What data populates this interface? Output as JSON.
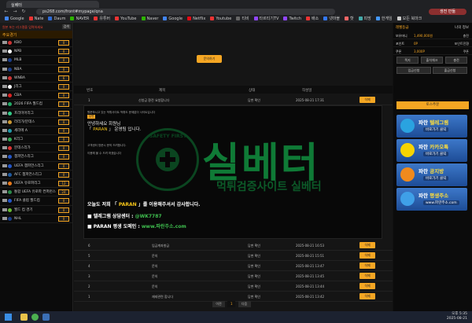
{
  "browser": {
    "tab_title": "실베터",
    "url": "ps268.com/front#mypage/qna",
    "profile_label": "생전 만듦",
    "bookmarks": [
      "Google",
      "Nate",
      "Daum",
      "NAVER",
      "유튜버",
      "YouTube",
      "Naver",
      "Google",
      "Netflix",
      "Youtube",
      "티비",
      "타르티기TV",
      "Twitch",
      "배소",
      "넷마블",
      "핫",
      "피망",
      "한게임",
      "모든 북마크"
    ]
  },
  "left_panel": {
    "header": "원본 또는 리그명을 입력하세요",
    "header_btn": "검색",
    "subheader": "주요경기",
    "leagues": [
      {
        "name": "KBO",
        "count": "0"
      },
      {
        "name": "NPB",
        "count": "0"
      },
      {
        "name": "MLB",
        "count": "0"
      },
      {
        "name": "NBA",
        "count": "0"
      },
      {
        "name": "WNBA",
        "count": "6"
      },
      {
        "name": "J리그",
        "count": "0"
      },
      {
        "name": "CBA",
        "count": "0"
      },
      {
        "name": "2026 FIFA 월드컵",
        "count": "0"
      },
      {
        "name": "프리미어리그",
        "count": "0"
      },
      {
        "name": "라리가/분데스",
        "count": "0"
      },
      {
        "name": "세리에 A",
        "count": "0"
      },
      {
        "name": "K리그",
        "count": "0"
      },
      {
        "name": "분데스리가",
        "count": "0"
      },
      {
        "name": "챔피언스리그",
        "count": "0"
      },
      {
        "name": "UEFA 챔피언스리그",
        "count": "0"
      },
      {
        "name": "AFC 챔피언스리그",
        "count": "0"
      },
      {
        "name": "UEFA 유로파리그",
        "count": "12"
      },
      {
        "name": "통합 UEFA 유로파 컨퍼런스",
        "count": "24"
      },
      {
        "name": "FIFA 클럽 월드컵",
        "count": "0"
      },
      {
        "name": "월드 컵 경기",
        "count": "0"
      },
      {
        "name": "NHL",
        "count": "0"
      }
    ]
  },
  "main": {
    "top_button": "문의하기",
    "table_headers": [
      "번호",
      "제목",
      "상태",
      "작성일"
    ],
    "first_row": {
      "num": "1",
      "title": "신청금 환전 요청합니다",
      "status": "답변 확인",
      "date": "2025-08-21 17:31",
      "btn": "삭제"
    },
    "message": {
      "small_lines": [
        "원문하시고 있는 먹튀사이트 먹튀도 문제없이 사이트입니다",
        "[답변]"
      ],
      "badge": "답변",
      "greeting1": "안녕하세요 회원님",
      "greeting2_pre": "「 ",
      "brand": "PARAN",
      "greeting2_post": " 」 운영팀 입니다.",
      "line1": "고객센터 방문시 문의 드려합니다.",
      "line2": "이용해 볼 수 드려 하겠습니다",
      "closing_pre": "오늘도 저희 「 ",
      "closing_brand": "PARAN",
      "closing_post": " 」를 이용해주셔서 감사합니다.",
      "tg_label": "■ 텔레그램 상담센터 : ",
      "tg_value": "@WK7787",
      "domain_label": "■ PARAN 평생 도메인 : ",
      "domain_value": "www.파란주소.com",
      "watermark": "실베터",
      "watermark_sub": "먹튀검증사이트 실베터",
      "seal_text": "SAFETY FIRST"
    },
    "rows": [
      {
        "num": "6",
        "title": "임금계좌발급",
        "status": "답변 확인",
        "date": "2025-08-21 16:53",
        "btn": "삭제"
      },
      {
        "num": "5",
        "title": "문의",
        "status": "답변 확인",
        "date": "2025-08-21 15:51",
        "btn": "삭제"
      },
      {
        "num": "4",
        "title": "문의",
        "status": "답변 확인",
        "date": "2025-08-21 13:47",
        "btn": "삭제"
      },
      {
        "num": "3",
        "title": "문의",
        "status": "답변 확인",
        "date": "2025-08-21 13:45",
        "btn": "삭제"
      },
      {
        "num": "2",
        "title": "문의",
        "status": "답변 확인",
        "date": "2025-08-21 13:44",
        "btn": "삭제"
      },
      {
        "num": "1",
        "title": "재테관련 합니다",
        "status": "답변 확인",
        "date": "2025-08-21 13:42",
        "btn": "삭제"
      }
    ],
    "pager": {
      "prev": "이전",
      "current": "1",
      "next": "다음"
    }
  },
  "right_panel": {
    "level_label": "레벨등급",
    "my_label": "나의 정보",
    "balance_label": "보유머니",
    "balance": "1,490,000원",
    "balance_right": "충전",
    "point_label": "포인트",
    "point": "0P",
    "point_right": "포인트전환",
    "coupon_label": "쿠폰",
    "coupon": "3,000P",
    "coupon_right": "쿠폰",
    "btn_row1": [
      "쪽지",
      "출석체크",
      "충전"
    ],
    "btn_row2": [
      "입금신청",
      "출금신청"
    ],
    "charge_btn": "토스주문",
    "banners": [
      {
        "title_pre": "파란 ",
        "title": "텔레그램",
        "sub": "바로가기 클릭",
        "color": "#2aa3e0"
      },
      {
        "title_pre": "파란 ",
        "title": "카카오톡",
        "sub": "바로가기 클릭",
        "color": "#f7d400"
      },
      {
        "title_pre": "파란 ",
        "title": "공지방",
        "sub": "바로가기 클릭",
        "color": "#f08a1d"
      },
      {
        "title_pre": "파란 ",
        "title": "평생주소",
        "sub": "www.파란주소.com",
        "color": "#3fa0e8"
      }
    ]
  },
  "taskbar": {
    "time": "오후 5:35",
    "date": "2025-08-21"
  }
}
